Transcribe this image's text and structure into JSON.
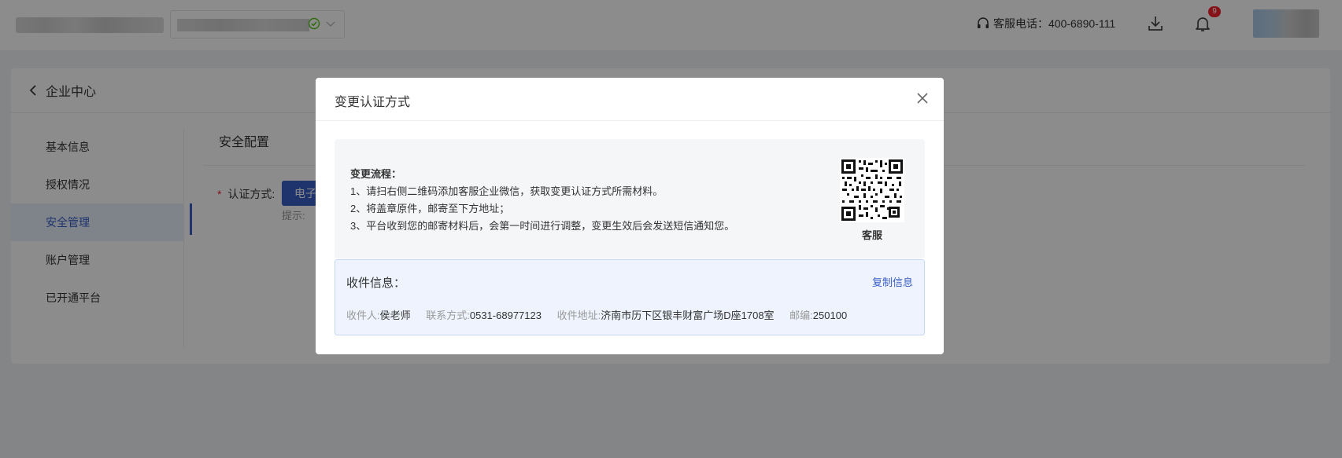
{
  "header": {
    "hotline_label": "客服电话：",
    "hotline_number": "400-6890-111",
    "notification_count": "9"
  },
  "page": {
    "back_title": "企业中心",
    "menu": [
      {
        "label": "基本信息"
      },
      {
        "label": "授权情况"
      },
      {
        "label": "安全管理"
      },
      {
        "label": "账户管理"
      },
      {
        "label": "已开通平台"
      }
    ],
    "section_title": "安全配置",
    "auth_label": "认证方式:",
    "auth_required_mark": "*",
    "auth_button": "电子",
    "hint": "提示:"
  },
  "modal": {
    "title": "变更认证方式",
    "flow_title": "变更流程：",
    "steps": [
      "1、请扫右侧二维码添加客服企业微信，获取变更认证方式所需材料。",
      "2、将盖章原件，邮寄至下方地址；",
      "3、平台收到您的邮寄材料后，会第一时间进行调整，变更生效后会发送短信通知您。"
    ],
    "qr_caption": "客服",
    "recipient": {
      "title": "收件信息：",
      "copy_label": "复制信息",
      "name_key": "收件人:",
      "name": "侯老师",
      "phone_key": "联系方式:",
      "phone": "0531-68977123",
      "address_key": "收件地址:",
      "address": "济南市历下区银丰财富广场D座1708室",
      "zip_key": "邮编:",
      "zip": "250100"
    }
  },
  "colors": {
    "primary": "#3a5ec7",
    "danger": "#f5222d",
    "success": "#52c41a"
  }
}
